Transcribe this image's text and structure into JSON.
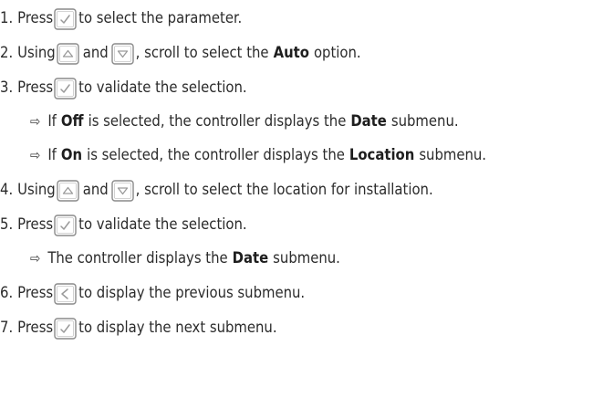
{
  "steps": [
    {
      "num": "1.",
      "parts": [
        "Press",
        "to select the parameter."
      ]
    },
    {
      "num": "2.",
      "parts": [
        "Using",
        "and",
        ", scroll to select the",
        "Auto",
        "option."
      ]
    },
    {
      "num": "3.",
      "parts": [
        "Press",
        "to validate the selection."
      ]
    },
    {
      "sub_a": [
        "If",
        "Off",
        "is selected, the controller displays the",
        "Date",
        "submenu."
      ]
    },
    {
      "sub_b": [
        "If",
        "On",
        "is selected, the controller displays the",
        "Location",
        "submenu."
      ]
    },
    {
      "num": "4.",
      "parts": [
        "Using",
        "and",
        ", scroll to select the location for installation."
      ]
    },
    {
      "num": "5.",
      "parts": [
        "Press",
        "to validate the selection."
      ]
    },
    {
      "sub_c": [
        "The controller displays the",
        "Date",
        "submenu."
      ]
    },
    {
      "num": "6.",
      "parts": [
        "Press",
        "to display the previous submenu."
      ]
    },
    {
      "num": "7.",
      "parts": [
        "Press",
        "to display the next submenu."
      ]
    }
  ],
  "bullet_arrow": "⇨",
  "icons": {
    "validate": "check-key-icon",
    "up": "up-key-icon",
    "down": "down-key-icon",
    "back": "left-key-icon"
  },
  "colors": {
    "text": "#2b2b2b",
    "key_border": "#8a8a8a",
    "key_glyph": "#9a9a9a"
  }
}
